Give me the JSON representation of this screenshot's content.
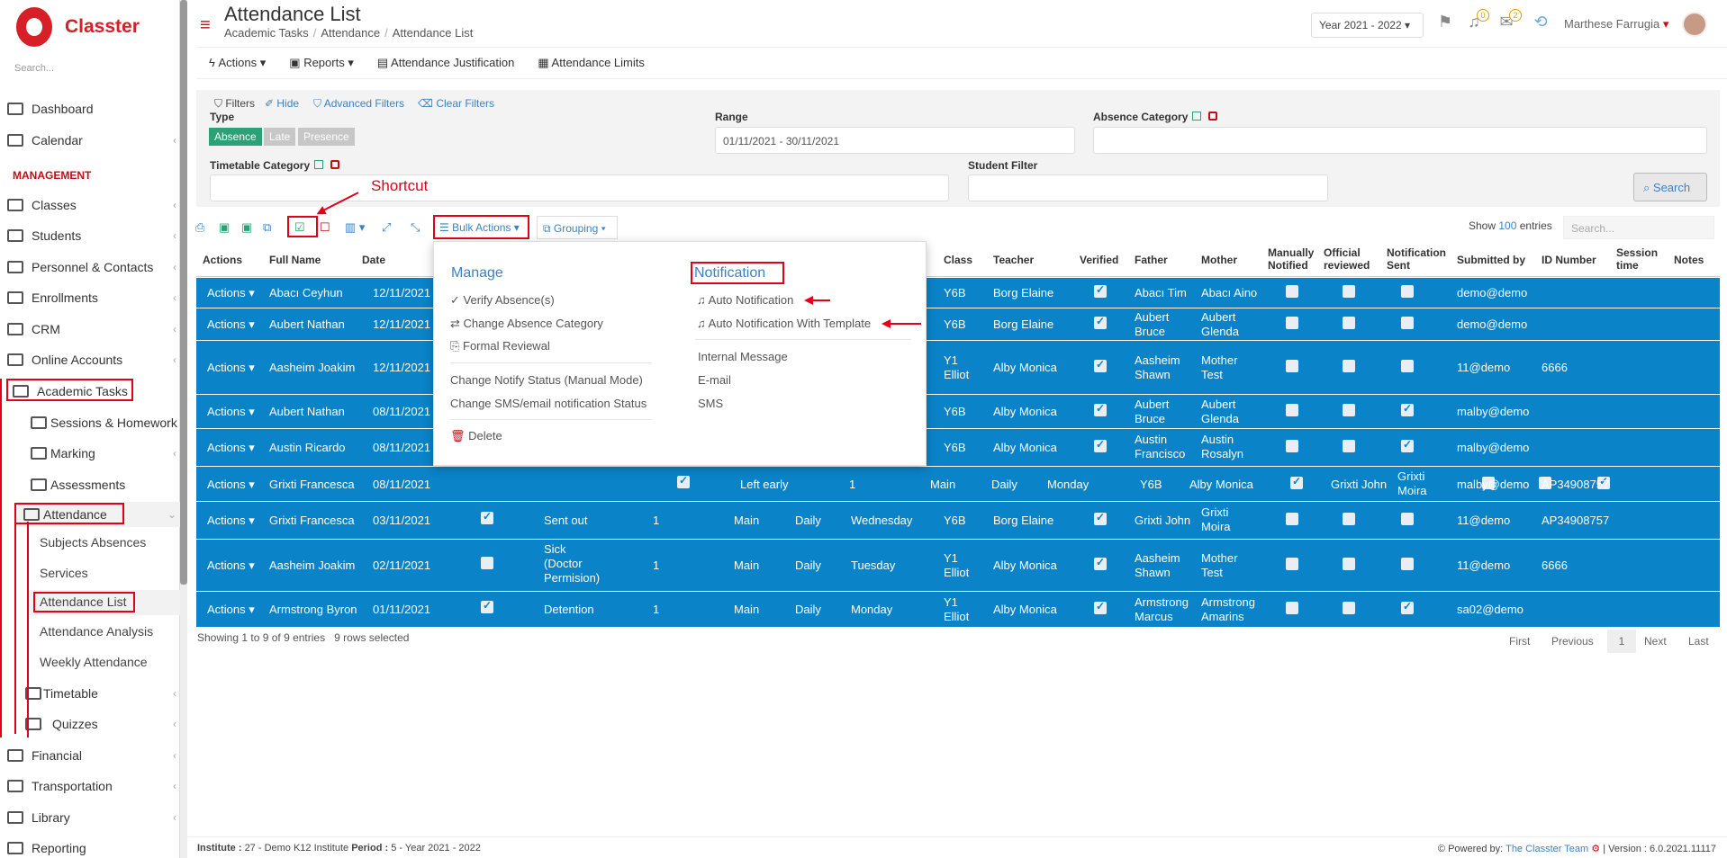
{
  "app": {
    "brand": "Classter",
    "search_placeholder": "Search..."
  },
  "sidebar": {
    "items": [
      {
        "label": "Dashboard"
      },
      {
        "label": "Calendar"
      },
      {
        "label": "Classes"
      },
      {
        "label": "Students"
      },
      {
        "label": "Personnel & Contacts"
      },
      {
        "label": "Enrollments"
      },
      {
        "label": "CRM"
      },
      {
        "label": "Online Accounts"
      },
      {
        "label": "Academic Tasks"
      },
      {
        "label": "Financial"
      },
      {
        "label": "Transportation"
      },
      {
        "label": "Library"
      },
      {
        "label": "Reporting"
      }
    ],
    "heading": "MANAGEMENT",
    "academic_sub": [
      {
        "label": "Sessions & Homework"
      },
      {
        "label": "Marking"
      },
      {
        "label": "Assessments"
      },
      {
        "label": "Attendance"
      }
    ],
    "attendance_sub": [
      {
        "label": "Subjects Absences"
      },
      {
        "label": "Services"
      },
      {
        "label": "Attendance List"
      },
      {
        "label": "Attendance Analysis"
      },
      {
        "label": "Weekly Attendance"
      }
    ],
    "more_sub": [
      {
        "label": "Timetable"
      },
      {
        "label": "Quizzes"
      }
    ]
  },
  "header": {
    "title": "Attendance List",
    "breadcrumb": [
      "Academic Tasks",
      "Attendance",
      "Attendance List"
    ],
    "year": "Year 2021 - 2022",
    "notif_count": "0",
    "mail_count": "2",
    "user": "Marthese Farrugia"
  },
  "toolbar": {
    "actions": "Actions",
    "reports": "Reports",
    "justification": "Attendance Justification",
    "limits": "Attendance Limits"
  },
  "filters": {
    "filters_label": "Filters",
    "hide": "Hide",
    "advanced": "Advanced Filters",
    "clear": "Clear Filters",
    "type_label": "Type",
    "type_tags": [
      "Absence",
      "Late",
      "Presence"
    ],
    "range_label": "Range",
    "range_value": "01/11/2021 - 30/11/2021",
    "absence_cat_label": "Absence Category",
    "timetable_cat_label": "Timetable Category",
    "student_filter_label": "Student Filter",
    "search_btn": "Search"
  },
  "annotation": {
    "shortcut": "Shortcut"
  },
  "table_tools": {
    "bulk": "Bulk Actions",
    "grouping": "Grouping",
    "show": "Show",
    "entries_count": "100",
    "entries": "entries",
    "search_placeholder": "Search..."
  },
  "table": {
    "headers": [
      "Actions",
      "Full Name",
      "Date",
      "Class",
      "Teacher",
      "Verified",
      "Father",
      "Mother",
      "Manually Notified",
      "Official reviewed",
      "Notification Sent",
      "Submitted by",
      "ID Number",
      "Session time",
      "Notes"
    ],
    "action_label": "Actions",
    "rows": [
      {
        "name": "Abacı Ceyhun",
        "date": "12/11/2021",
        "reason": "",
        "num": "",
        "type": "",
        "freq": "",
        "day": "",
        "klass": "Y6B",
        "teacher": "Borg Elaine",
        "father": "Abacı Tim",
        "mother": "Abacı Aino",
        "by": "demo@demo",
        "idn": ""
      },
      {
        "name": "Aubert Nathan",
        "date": "12/11/2021",
        "reason": "",
        "num": "",
        "type": "",
        "freq": "",
        "day": "",
        "klass": "Y6B",
        "teacher": "Borg Elaine",
        "father": "Aubert Bruce",
        "mother": "Aubert Glenda",
        "by": "demo@demo",
        "idn": ""
      },
      {
        "name": "Aasheim Joakim",
        "date": "12/11/2021",
        "reason": "",
        "num": "",
        "type": "",
        "freq": "",
        "day": "",
        "klass": "Y1 Elliot",
        "teacher": "Alby Monica",
        "father": "Aasheim Shawn",
        "mother": "Mother Test",
        "by": "11@demo",
        "idn": "6666"
      },
      {
        "name": "Aubert Nathan",
        "date": "08/11/2021",
        "reason": "",
        "num": "",
        "type": "",
        "freq": "",
        "day": "",
        "klass": "Y6B",
        "teacher": "Alby Monica",
        "father": "Aubert Bruce",
        "mother": "Aubert Glenda",
        "by": "malby@demo",
        "idn": ""
      },
      {
        "name": "Austin Ricardo",
        "date": "08/11/2021",
        "reason": "",
        "num": "",
        "type": "",
        "freq": "",
        "day": "",
        "klass": "Y6B",
        "teacher": "Alby Monica",
        "father": "Austin Francisco",
        "mother": "Austin Rosalyn",
        "by": "malby@demo",
        "idn": ""
      },
      {
        "name": "Grixti Francesca",
        "date": "08/11/2021",
        "reason": "Left early",
        "num": "1",
        "type": "Main",
        "freq": "Daily",
        "day": "Monday",
        "klass": "Y6B",
        "teacher": "Alby Monica",
        "father": "Grixti John",
        "mother": "Grixti Moira",
        "by": "malby@demo",
        "idn": "AP34908757"
      },
      {
        "name": "Grixti Francesca",
        "date": "03/11/2021",
        "reason": "Sent out",
        "num": "1",
        "type": "Main",
        "freq": "Daily",
        "day": "Wednesday",
        "klass": "Y6B",
        "teacher": "Borg Elaine",
        "father": "Grixti John",
        "mother": "Grixti Moira",
        "by": "11@demo",
        "idn": "AP34908757"
      },
      {
        "name": "Aasheim Joakim",
        "date": "02/11/2021",
        "reason": "Sick (Doctor Permision)",
        "num": "1",
        "type": "Main",
        "freq": "Daily",
        "day": "Tuesday",
        "klass": "Y1 Elliot",
        "teacher": "Alby Monica",
        "father": "Aasheim Shawn",
        "mother": "Mother Test",
        "by": "11@demo",
        "idn": "6666"
      },
      {
        "name": "Armstrong Byron",
        "date": "01/11/2021",
        "reason": "Detention",
        "num": "1",
        "type": "Main",
        "freq": "Daily",
        "day": "Monday",
        "klass": "Y1 Elliot",
        "teacher": "Alby Monica",
        "father": "Armstrong Marcus",
        "mother": "Armstrong Amarins",
        "by": "sa02@demo",
        "idn": ""
      }
    ]
  },
  "dropdown": {
    "manage": "Manage",
    "manage_items": [
      "Verify Absence(s)",
      "Change Absence Category",
      "Formal Reviewal"
    ],
    "notify_items": [
      "Change Notify Status (Manual Mode)",
      "Change SMS/email notification Status"
    ],
    "delete": "Delete",
    "notification": "Notification",
    "notif_items": [
      "Auto Notification",
      "Auto Notification With Template"
    ],
    "other_items": [
      "Internal Message",
      "E-mail",
      "SMS"
    ]
  },
  "footer": {
    "showing": "Showing 1 to 9 of 9 entries",
    "selected": "9 rows selected",
    "pager": [
      "First",
      "Previous",
      "1",
      "Next",
      "Last"
    ],
    "institute_label": "Institute :",
    "institute": "27 - Demo K12 Institute",
    "period_label": "Period :",
    "period": "5 - Year 2021 - 2022",
    "powered_label": "Powered by:",
    "powered": "The Classter Team",
    "version": "| Version : 6.0.2021.11117"
  },
  "colors": {
    "accent": "#c10e15",
    "row": "#0a83c8",
    "link": "#3c82c2",
    "annotation": "#e0001b"
  }
}
